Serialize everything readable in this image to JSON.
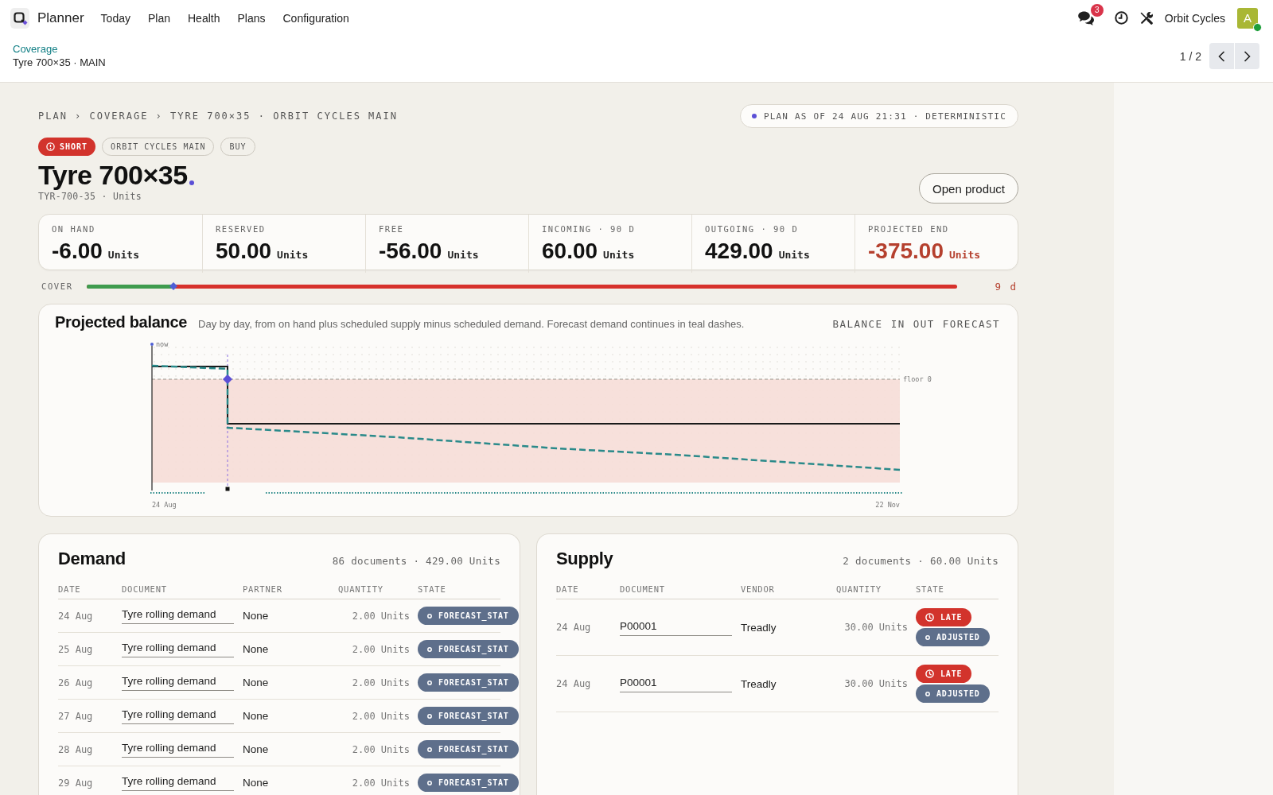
{
  "topbar": {
    "app_name": "Planner",
    "menu": [
      "Today",
      "Plan",
      "Health",
      "Plans",
      "Configuration"
    ],
    "messages_badge": "3",
    "company": "Orbit Cycles",
    "avatar_letter": "A",
    "online": true
  },
  "control_panel": {
    "breadcrumb_link": "Coverage",
    "breadcrumb_current": "Tyre 700×35 · MAIN",
    "pager": "1 / 2"
  },
  "page": {
    "breadcrumb": "PLAN › COVERAGE › TYRE 700×35 · ORBIT CYCLES MAIN",
    "plan_status": "PLAN AS OF 24 AUG 21:31 · DETERMINISTIC",
    "tags": [
      {
        "label": "SHORT",
        "kind": "alert"
      },
      {
        "label": "ORBIT CYCLES MAIN",
        "kind": "outline"
      },
      {
        "label": "BUY",
        "kind": "outline"
      }
    ],
    "title": "Tyre 700×35",
    "subtitle": "TYR-700-35 · Units",
    "open_button": "Open product"
  },
  "kpis": [
    {
      "label": "ON HAND",
      "value": "-6.00",
      "unit": "Units",
      "alert": false
    },
    {
      "label": "RESERVED",
      "value": "50.00",
      "unit": "Units",
      "alert": false
    },
    {
      "label": "FREE",
      "value": "-56.00",
      "unit": "Units",
      "alert": false
    },
    {
      "label": "INCOMING · 90 D",
      "value": "60.00",
      "unit": "Units",
      "alert": false
    },
    {
      "label": "OUTGOING · 90 D",
      "value": "429.00",
      "unit": "Units",
      "alert": false
    },
    {
      "label": "PROJECTED END",
      "value": "-375.00",
      "unit": "Units",
      "alert": true
    }
  ],
  "cover": {
    "label": "COVER",
    "level": 0.1,
    "reading": "9 d"
  },
  "balance_chart": {
    "title": "Projected balance",
    "description": "Day by day, from on hand plus scheduled supply minus scheduled demand. Forecast demand continues in teal dashes.",
    "legend": [
      "BALANCE",
      "IN",
      "OUT",
      "FORECAST"
    ],
    "now_label": "now",
    "floor_label": "floor 0",
    "x_labels": [
      "24 Aug",
      "22 Nov"
    ]
  },
  "demand": {
    "title": "Demand",
    "summary": "86 documents · 429.00 Units",
    "columns": [
      "DATE",
      "DOCUMENT",
      "PARTNER",
      "QUANTITY",
      "STATE"
    ],
    "rows": [
      {
        "date": "24 Aug",
        "document": "Tyre rolling demand",
        "partner": "None",
        "quantity": "2.00 Units",
        "states": [
          {
            "label": "FORECAST_STAT",
            "kind": "info"
          }
        ]
      },
      {
        "date": "25 Aug",
        "document": "Tyre rolling demand",
        "partner": "None",
        "quantity": "2.00 Units",
        "states": [
          {
            "label": "FORECAST_STAT",
            "kind": "info"
          }
        ]
      },
      {
        "date": "26 Aug",
        "document": "Tyre rolling demand",
        "partner": "None",
        "quantity": "2.00 Units",
        "states": [
          {
            "label": "FORECAST_STAT",
            "kind": "info"
          }
        ]
      },
      {
        "date": "27 Aug",
        "document": "Tyre rolling demand",
        "partner": "None",
        "quantity": "2.00 Units",
        "states": [
          {
            "label": "FORECAST_STAT",
            "kind": "info"
          }
        ]
      },
      {
        "date": "28 Aug",
        "document": "Tyre rolling demand",
        "partner": "None",
        "quantity": "2.00 Units",
        "states": [
          {
            "label": "FORECAST_STAT",
            "kind": "info"
          }
        ]
      },
      {
        "date": "29 Aug",
        "document": "Tyre rolling demand",
        "partner": "None",
        "quantity": "2.00 Units",
        "states": [
          {
            "label": "FORECAST_STAT",
            "kind": "info"
          }
        ]
      }
    ]
  },
  "supply": {
    "title": "Supply",
    "summary": "2 documents · 60.00 Units",
    "columns": [
      "DATE",
      "DOCUMENT",
      "VENDOR",
      "QUANTITY",
      "STATE"
    ],
    "rows": [
      {
        "date": "24 Aug",
        "document": "P00001",
        "vendor": "Treadly",
        "quantity": "30.00 Units",
        "states": [
          {
            "label": "LATE",
            "kind": "late"
          },
          {
            "label": "ADJUSTED",
            "kind": "info"
          }
        ]
      },
      {
        "date": "24 Aug",
        "document": "P00001",
        "vendor": "Treadly",
        "quantity": "30.00 Units",
        "states": [
          {
            "label": "LATE",
            "kind": "late"
          },
          {
            "label": "ADJUSTED",
            "kind": "info"
          }
        ]
      }
    ]
  }
}
